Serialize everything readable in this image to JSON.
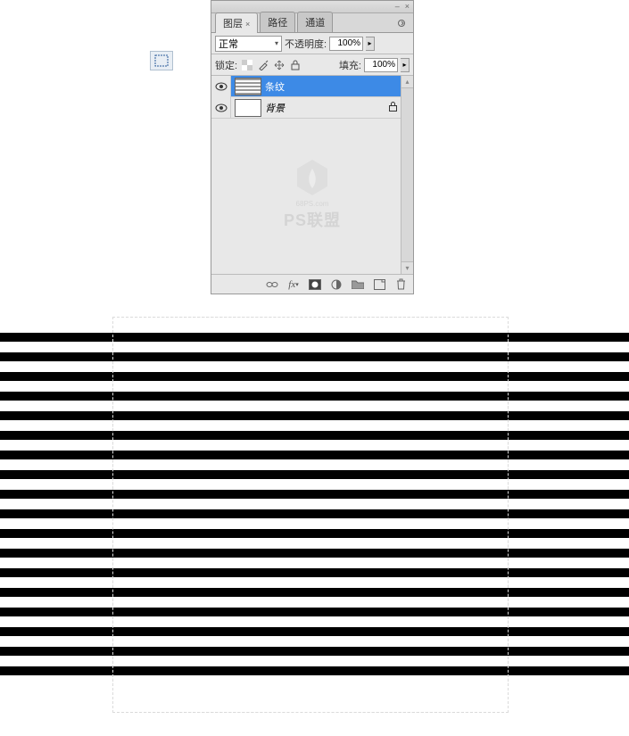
{
  "tool": {
    "name": "rectangular-marquee"
  },
  "panel": {
    "tabs": {
      "layers": "图层",
      "paths": "路径",
      "channels": "通道"
    },
    "blend_mode": "正常",
    "opacity_label": "不透明度:",
    "opacity_value": "100%",
    "fill_label": "填充:",
    "fill_value": "100%",
    "lock_label": "锁定:",
    "layers": [
      {
        "name": "条纹",
        "selected": true,
        "locked": false
      },
      {
        "name": "背景",
        "selected": false,
        "locked": true
      }
    ]
  },
  "watermark": {
    "small": "68PS.com",
    "big": "PS联盟"
  }
}
